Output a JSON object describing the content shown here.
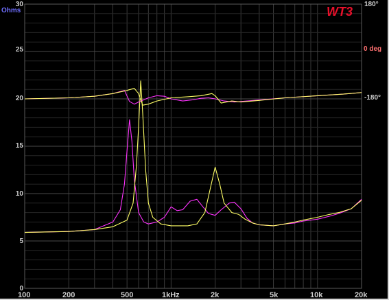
{
  "logo": "WT3",
  "left_axis_unit": "Ohms",
  "right_axis_unit": "0 deg",
  "colors": {
    "background": "#000000",
    "grid": "#3a3a3a",
    "trace_a": "#ff33ff",
    "trace_b": "#ffff66",
    "left_unit": "#6f6fff",
    "right_unit": "#ff7070",
    "logo": "#e8102a"
  },
  "chart_data": {
    "type": "line",
    "x_scale": "log",
    "xlim": [
      100,
      20000
    ],
    "ylim": [
      0,
      30
    ],
    "y_ticks": [
      "0",
      "5",
      "10",
      "15",
      "20",
      "25",
      "30"
    ],
    "x_ticks": [
      {
        "value": 100,
        "label": "100"
      },
      {
        "value": 200,
        "label": "200"
      },
      {
        "value": 500,
        "label": "500"
      },
      {
        "value": 1000,
        "label": "1kHz"
      },
      {
        "value": 2000,
        "label": "2k"
      },
      {
        "value": 5000,
        "label": "5k"
      },
      {
        "value": 10000,
        "label": "10k"
      },
      {
        "value": 20000,
        "label": "20k"
      }
    ],
    "right_axis": {
      "ylim": [
        -360,
        180
      ],
      "ticks": [
        {
          "value": 180,
          "label": "180°"
        },
        {
          "value": 0,
          "label": "0 deg"
        },
        {
          "value": -180,
          "label": "-180°"
        }
      ]
    },
    "grid": true,
    "series": [
      {
        "color": "#ff33ff",
        "kind": "impedance",
        "points": [
          [
            100,
            5.9
          ],
          [
            200,
            6.0
          ],
          [
            300,
            6.2
          ],
          [
            400,
            7.0
          ],
          [
            450,
            8.3
          ],
          [
            480,
            11
          ],
          [
            500,
            14.5
          ],
          [
            520,
            17.8
          ],
          [
            540,
            15.5
          ],
          [
            560,
            11.5
          ],
          [
            600,
            8.0
          ],
          [
            650,
            7.0
          ],
          [
            700,
            6.8
          ],
          [
            800,
            7.0
          ],
          [
            900,
            7.5
          ],
          [
            1000,
            8.6
          ],
          [
            1100,
            8.2
          ],
          [
            1200,
            8.3
          ],
          [
            1350,
            9.2
          ],
          [
            1500,
            9.4
          ],
          [
            1650,
            8.6
          ],
          [
            1800,
            7.9
          ],
          [
            2000,
            7.7
          ],
          [
            2200,
            8.3
          ],
          [
            2500,
            9.0
          ],
          [
            2700,
            9.1
          ],
          [
            3000,
            8.4
          ],
          [
            3300,
            7.4
          ],
          [
            3600,
            6.9
          ],
          [
            4000,
            6.7
          ],
          [
            5000,
            6.6
          ],
          [
            6000,
            6.8
          ],
          [
            7000,
            6.9
          ],
          [
            8000,
            7.1
          ],
          [
            10000,
            7.3
          ],
          [
            12000,
            7.6
          ],
          [
            14000,
            7.9
          ],
          [
            17000,
            8.4
          ],
          [
            20000,
            9.4
          ]
        ]
      },
      {
        "color": "#ffff66",
        "kind": "impedance",
        "points": [
          [
            100,
            5.9
          ],
          [
            200,
            6.0
          ],
          [
            300,
            6.2
          ],
          [
            400,
            6.5
          ],
          [
            500,
            7.2
          ],
          [
            550,
            9.0
          ],
          [
            580,
            13.0
          ],
          [
            600,
            17.0
          ],
          [
            620,
            21.9
          ],
          [
            640,
            18.5
          ],
          [
            670,
            12.5
          ],
          [
            700,
            9.0
          ],
          [
            750,
            7.5
          ],
          [
            850,
            6.8
          ],
          [
            1000,
            6.6
          ],
          [
            1300,
            6.6
          ],
          [
            1500,
            6.8
          ],
          [
            1700,
            8.0
          ],
          [
            1850,
            10.5
          ],
          [
            2000,
            12.8
          ],
          [
            2150,
            11.0
          ],
          [
            2300,
            9.0
          ],
          [
            2600,
            8.0
          ],
          [
            2900,
            7.8
          ],
          [
            3200,
            7.3
          ],
          [
            3600,
            6.9
          ],
          [
            4000,
            6.7
          ],
          [
            5000,
            6.6
          ],
          [
            6000,
            6.8
          ],
          [
            7000,
            7.0
          ],
          [
            8000,
            7.2
          ],
          [
            10000,
            7.5
          ],
          [
            12000,
            7.8
          ],
          [
            14000,
            8.0
          ],
          [
            17000,
            8.4
          ],
          [
            20000,
            9.3
          ]
        ]
      },
      {
        "color": "#ff33ff",
        "kind": "phase",
        "points": [
          [
            100,
            0
          ],
          [
            200,
            2
          ],
          [
            300,
            5
          ],
          [
            400,
            10
          ],
          [
            480,
            16
          ],
          [
            520,
            -5
          ],
          [
            560,
            -10
          ],
          [
            600,
            -6
          ],
          [
            700,
            2
          ],
          [
            800,
            6
          ],
          [
            900,
            5
          ],
          [
            1000,
            0
          ],
          [
            1200,
            -4
          ],
          [
            1400,
            -2
          ],
          [
            1600,
            1
          ],
          [
            1800,
            2
          ],
          [
            2000,
            0
          ],
          [
            2300,
            -4
          ],
          [
            2700,
            -6
          ],
          [
            3000,
            -5
          ],
          [
            4000,
            -2
          ],
          [
            6000,
            2
          ],
          [
            10000,
            6
          ],
          [
            15000,
            9
          ],
          [
            20000,
            12
          ]
        ]
      },
      {
        "color": "#ffff66",
        "kind": "phase",
        "points": [
          [
            100,
            0
          ],
          [
            200,
            2
          ],
          [
            300,
            5
          ],
          [
            400,
            10
          ],
          [
            500,
            16
          ],
          [
            560,
            20
          ],
          [
            600,
            10
          ],
          [
            640,
            -12
          ],
          [
            700,
            -10
          ],
          [
            800,
            -4
          ],
          [
            1000,
            2
          ],
          [
            1300,
            4
          ],
          [
            1600,
            6
          ],
          [
            1900,
            10
          ],
          [
            2000,
            6
          ],
          [
            2200,
            -8
          ],
          [
            2600,
            -4
          ],
          [
            3000,
            -6
          ],
          [
            4000,
            -3
          ],
          [
            6000,
            2
          ],
          [
            10000,
            6
          ],
          [
            15000,
            9
          ],
          [
            20000,
            12
          ]
        ]
      }
    ]
  }
}
